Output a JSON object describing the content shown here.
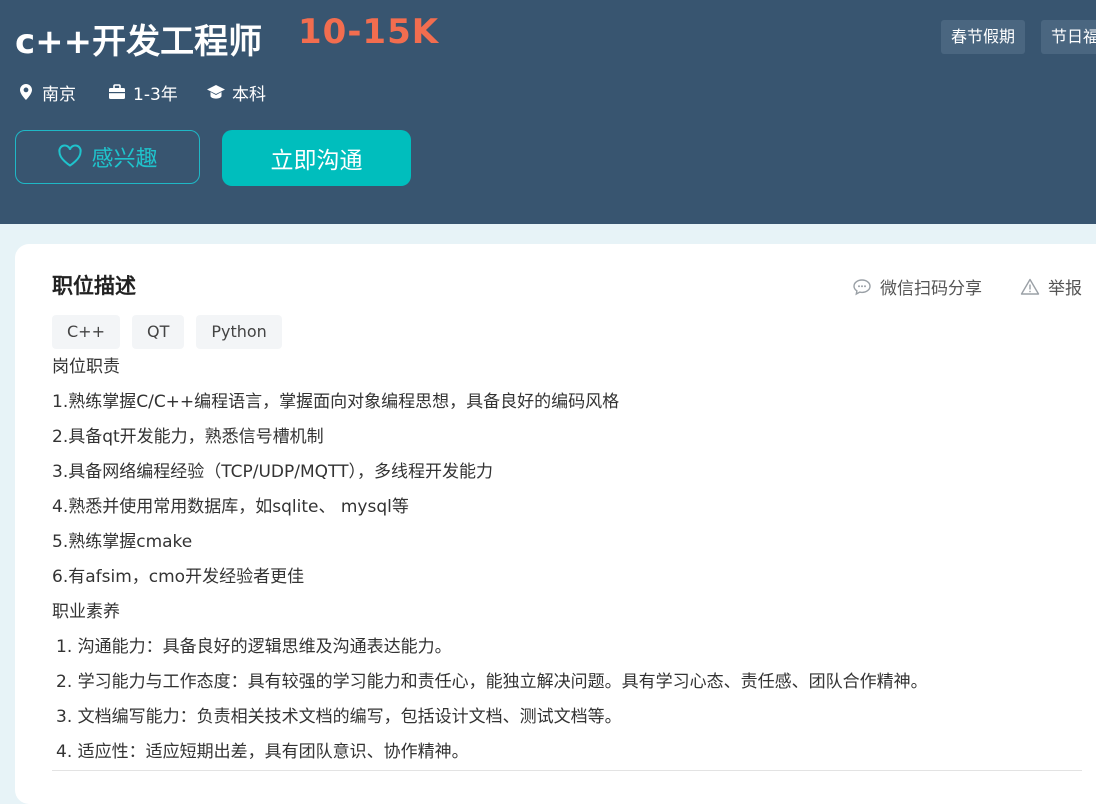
{
  "job": {
    "title": "c++开发工程师",
    "salary": "10-15K",
    "location": "南京",
    "experience": "1-3年",
    "degree": "本科"
  },
  "benefits": [
    "春节假期",
    "节日福利"
  ],
  "actions": {
    "interest_label": "感兴趣",
    "chat_label": "立即沟通"
  },
  "description": {
    "section_title": "职位描述",
    "share_label": "微信扫码分享",
    "report_label": "举报",
    "skills": [
      "C++",
      "QT",
      "Python"
    ],
    "lines": [
      "岗位职责",
      "1.熟练掌握C/C++编程语言，掌握面向对象编程思想，具备良好的编码风格",
      "2.具备qt开发能力，熟悉信号槽机制",
      "3.具备网络编程经验（TCP/UDP/MQTT），多线程开发能力",
      "4.熟悉并使用常用数据库，如sqlite、 mysql等",
      "5.熟练掌握cmake",
      "6.有afsim，cmo开发经验者更佳",
      "职业素养",
      "1. 沟通能力：具备良好的逻辑思维及沟通表达能力。",
      "2. 学习能力与工作态度：具有较强的学习能力和责任心，能独立解决问题。具有学习心态、责任感、团队合作精神。",
      "3. 文档编写能力：负责相关技术文档的编写，包括设计文档、测试文档等。",
      "4. 适应性：适应短期出差，具有团队意识、协作精神。"
    ]
  },
  "colors": {
    "header_bg": "#385570",
    "salary": "#f26d4f",
    "accent": "#00bebd"
  },
  "icons": {
    "location": "location-pin-icon",
    "experience": "briefcase-icon",
    "degree": "graduation-cap-icon",
    "interest": "heart-icon",
    "share": "chat-bubble-icon",
    "report": "warning-triangle-icon"
  }
}
